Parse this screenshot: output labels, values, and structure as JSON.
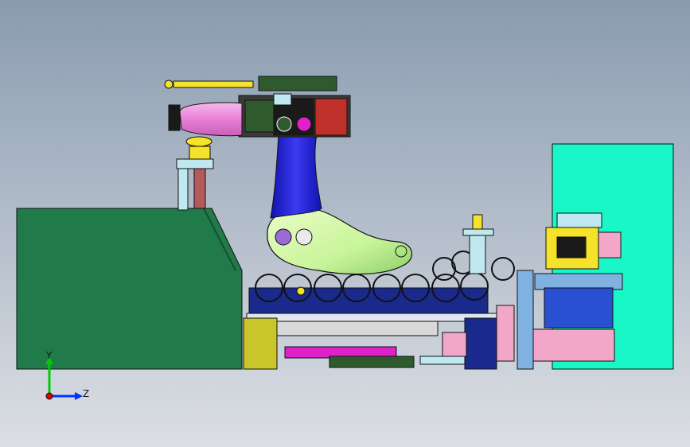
{
  "viewport": {
    "background_top": "#8a9bb0",
    "background_bottom": "#dcdfe4"
  },
  "triad": {
    "y_label": "Y",
    "z_label": "Z",
    "y_color": "#00cc00",
    "z_color": "#0033ff",
    "origin_color": "#e00000"
  },
  "palette": {
    "outline": "#1a1a1a",
    "guard_green": "#217a4a",
    "cyan_panel": "#19f7c8",
    "robot_blue": "#1f1fd6",
    "robot_arm_green": "#c9f59a",
    "forearm_pink": "#f090e0",
    "olive": "#c9c62b",
    "magenta": "#e020c8",
    "navy": "#1a2a8c",
    "pink": "#f2a6c8",
    "yellow": "#f5e22a",
    "light_cyan": "#bfe8f0",
    "light_blue": "#7fb2e0",
    "dark_green": "#2e5a2e"
  }
}
